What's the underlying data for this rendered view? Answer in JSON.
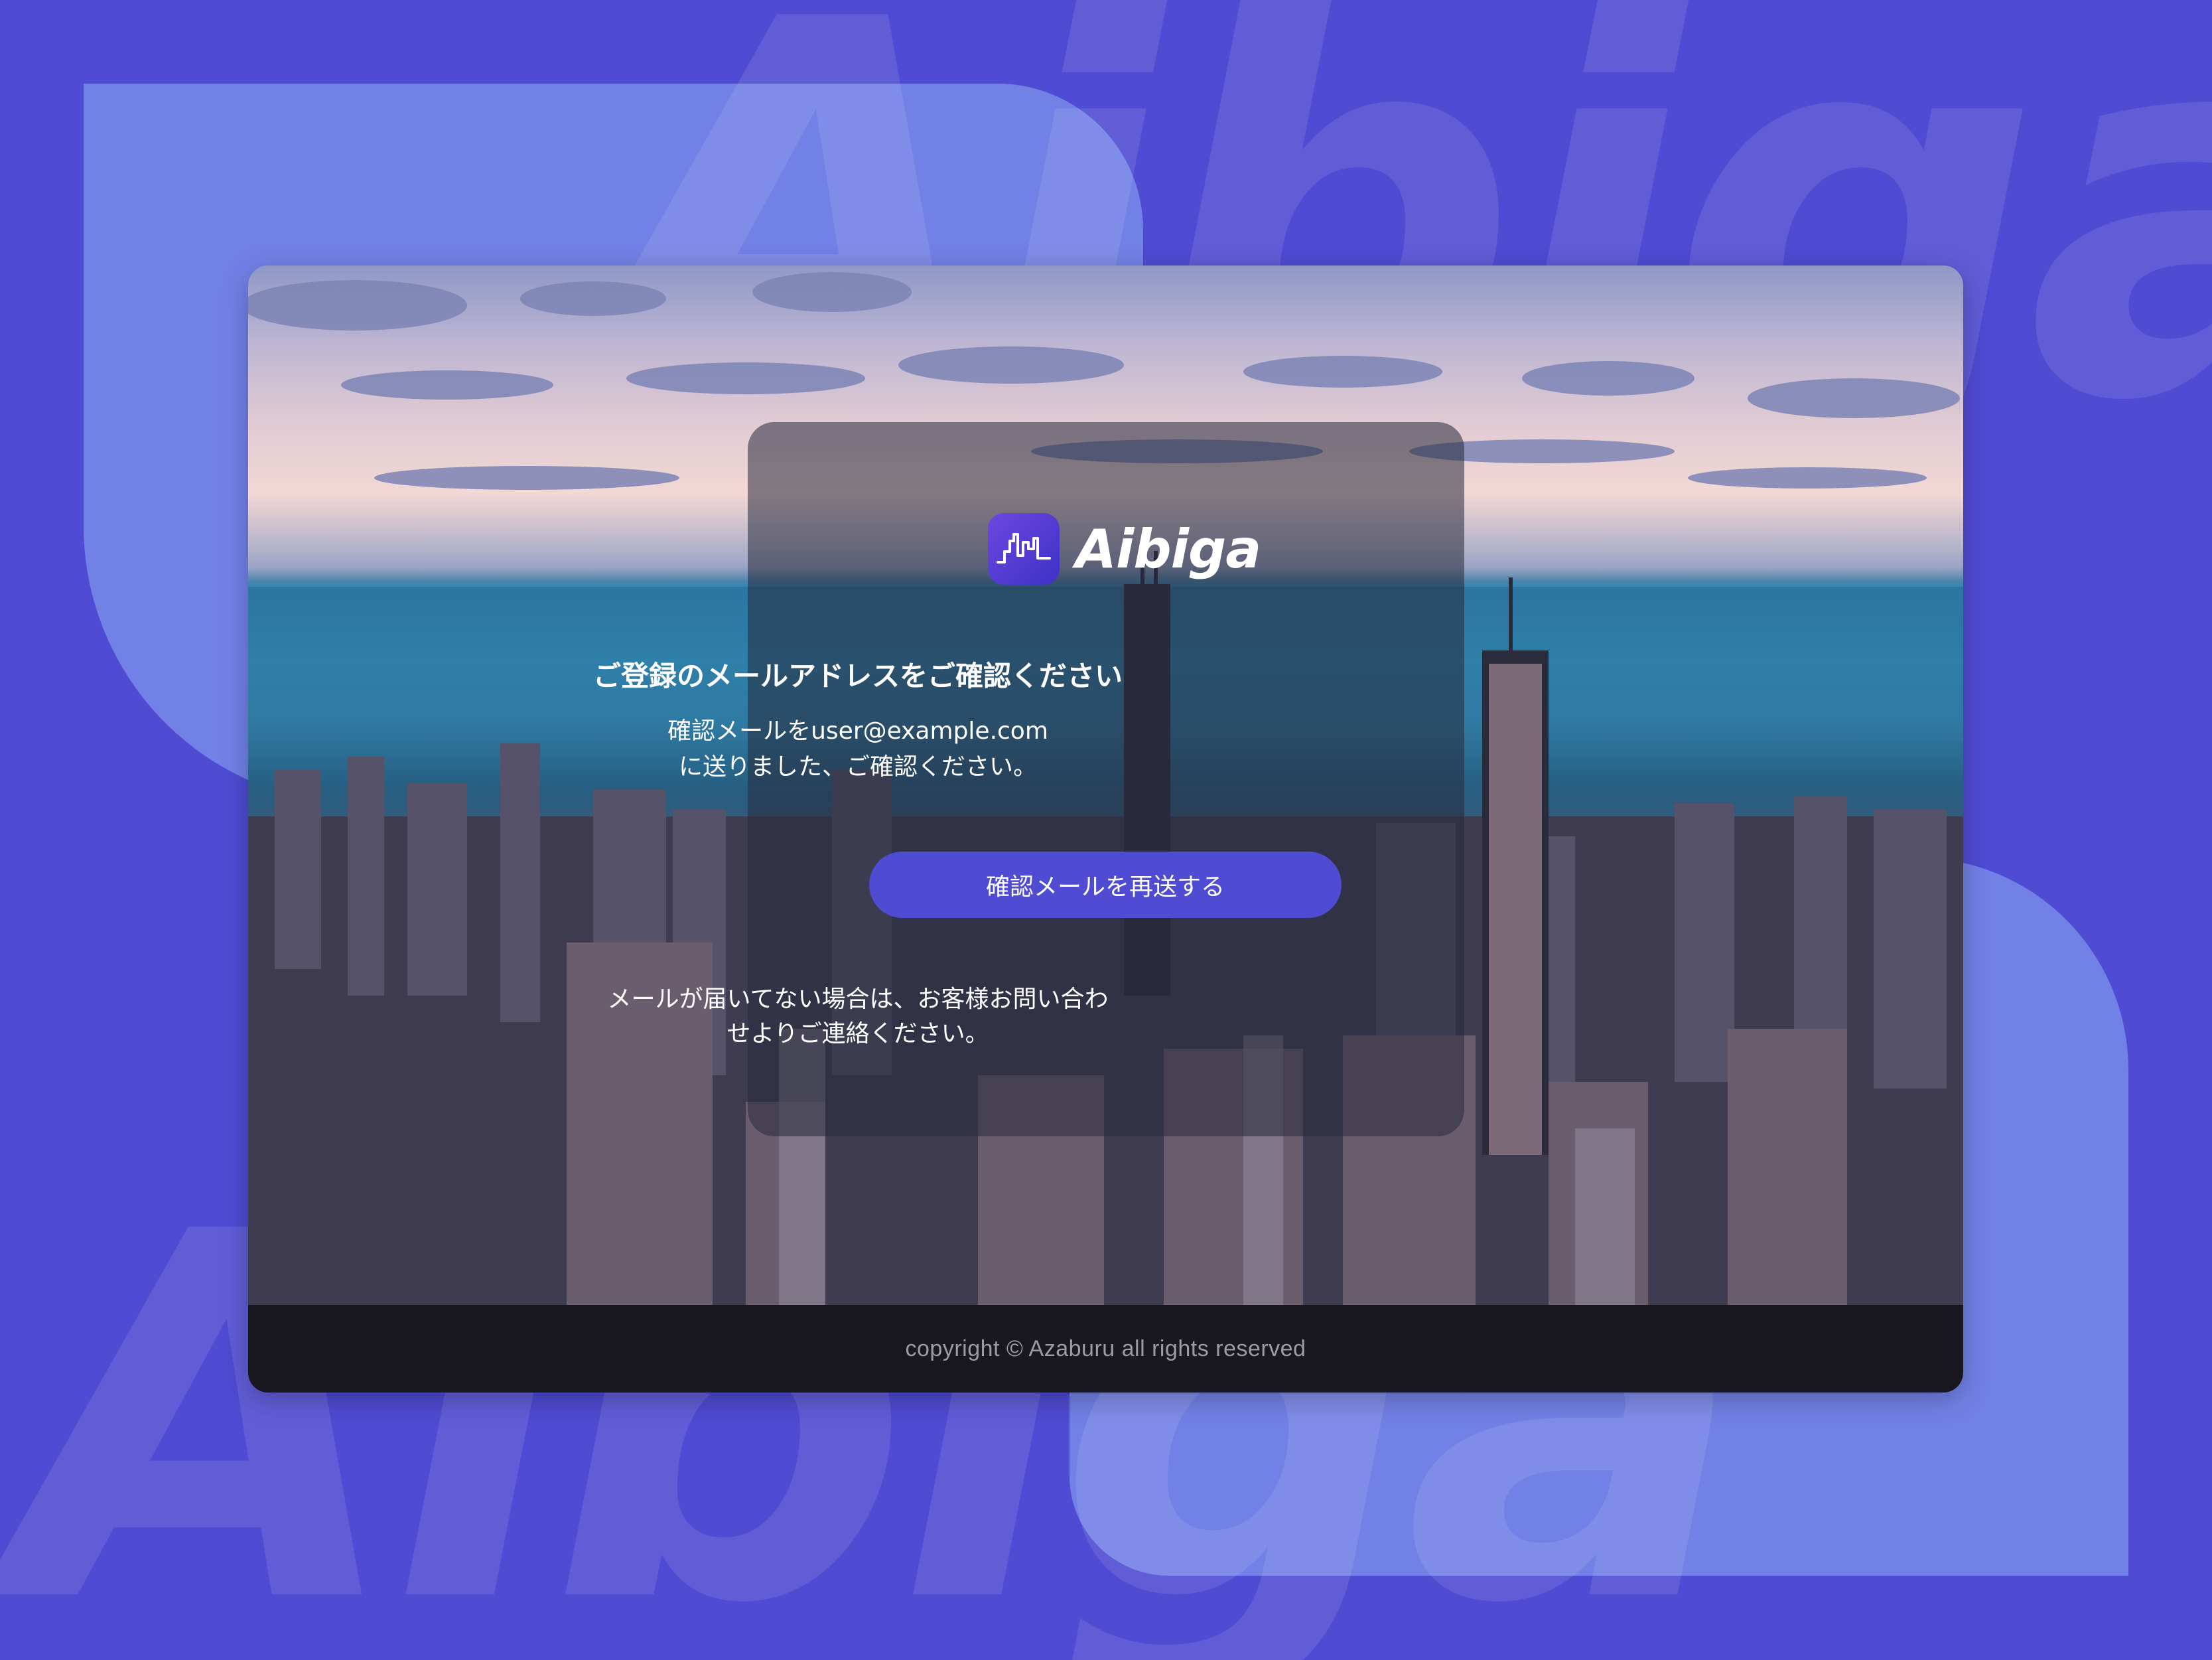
{
  "brand": {
    "name": "Aibiga",
    "logo_icon": "city-skyline-icon",
    "watermark_text": "Aibiga"
  },
  "verification": {
    "heading": "ご登録のメールアドレスをご確認ください",
    "message_line1": "確認メールをuser@example.com",
    "message_line2": "に送りました、ご確認ください。",
    "resend_button_label": "確認メールを再送する",
    "notice_line1": "メールが届いてない場合は、お客様お問い合わ",
    "notice_line2": "せよりご連絡ください。"
  },
  "footer": {
    "copyright": "copyright © Azaburu all rights reserved"
  },
  "colors": {
    "background": "#4f4bd3",
    "accent_shape": "#7281e6",
    "button": "#4f4bd3",
    "footer": "#19181e"
  }
}
